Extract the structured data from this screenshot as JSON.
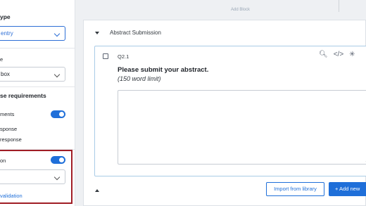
{
  "left_panel": {
    "question_type_title": "ype",
    "question_type_value": "entry",
    "type_label": "e",
    "type_value": "box",
    "response_title": "se requirements",
    "toggle1_label": "ments",
    "option1": "sponse",
    "option2": "response",
    "validation_label": "on",
    "validation_link": "validation"
  },
  "top": {
    "note": "Add Block"
  },
  "block": {
    "title": "Abstract Submission",
    "question": {
      "number": "Q2.1",
      "title": "Please submit your abstract.",
      "subtitle": "(150 word limit)",
      "icons": [
        "search-icon",
        "code-icon",
        "required-icon"
      ]
    },
    "import_label": "Import from library",
    "add_label": "+ Add new"
  },
  "colors": {
    "accent": "#1f6fd9",
    "highlight": "#a01d25"
  }
}
